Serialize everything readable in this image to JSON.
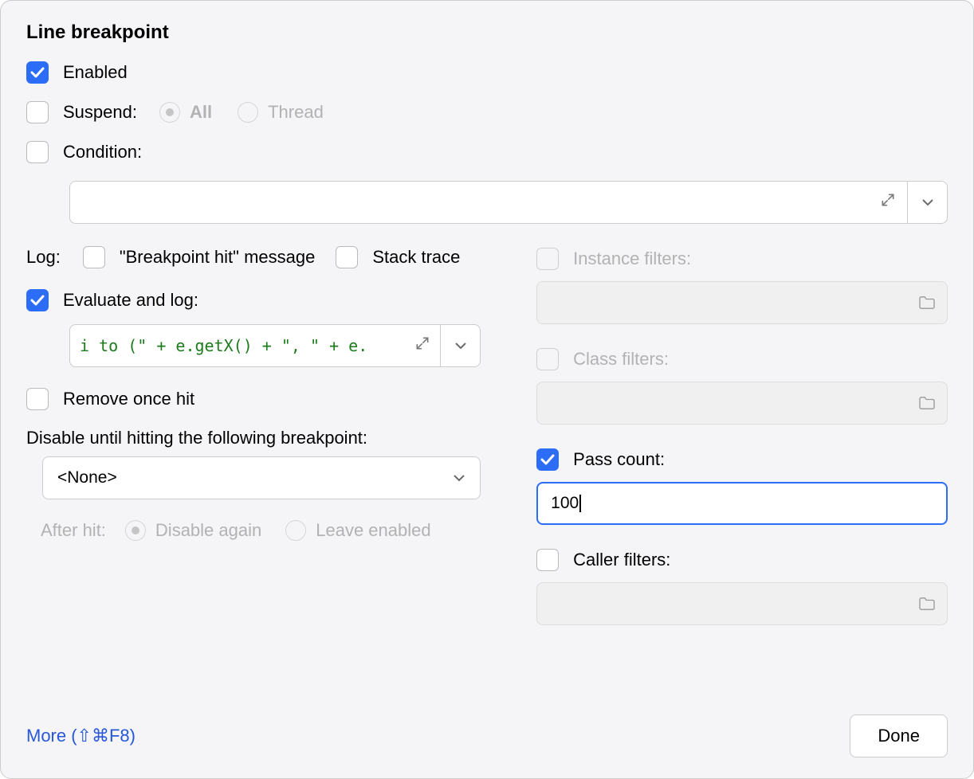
{
  "title": "Line breakpoint",
  "enabled": {
    "label": "Enabled",
    "checked": true
  },
  "suspend": {
    "label": "Suspend:",
    "checked": false,
    "options": [
      {
        "label": "All",
        "selected": true
      },
      {
        "label": "Thread",
        "selected": false
      }
    ]
  },
  "condition": {
    "label": "Condition:",
    "checked": false,
    "value": ""
  },
  "log": {
    "label": "Log:",
    "hit_message": {
      "label": "\"Breakpoint hit\" message",
      "checked": false
    },
    "stack_trace": {
      "label": "Stack trace",
      "checked": false
    }
  },
  "evaluate": {
    "label": "Evaluate and log:",
    "checked": true,
    "code": "i to (\" + e.getX() + \", \" + e."
  },
  "remove_once_hit": {
    "label": "Remove once hit",
    "checked": false
  },
  "disable_until": {
    "label": "Disable until hitting the following breakpoint:",
    "selected": "<None>"
  },
  "after_hit": {
    "label": "After hit:",
    "options": [
      {
        "label": "Disable again",
        "selected": true
      },
      {
        "label": "Leave enabled",
        "selected": false
      }
    ]
  },
  "instance_filters": {
    "label": "Instance filters:",
    "enabled": false,
    "value": ""
  },
  "class_filters": {
    "label": "Class filters:",
    "enabled": false,
    "value": ""
  },
  "pass_count": {
    "label": "Pass count:",
    "checked": true,
    "value": "100"
  },
  "caller_filters": {
    "label": "Caller filters:",
    "checked": false,
    "value": ""
  },
  "footer": {
    "more_link": "More (⇧⌘F8)",
    "done": "Done"
  }
}
